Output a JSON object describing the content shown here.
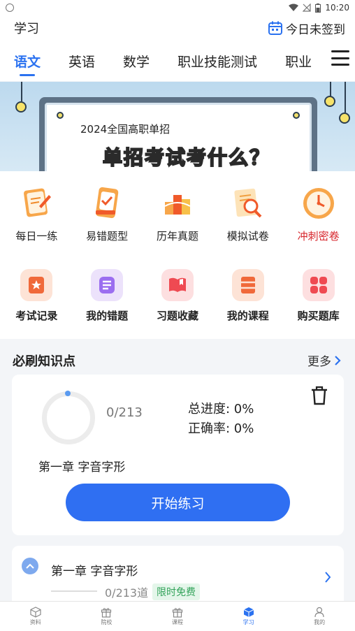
{
  "status_bar": {
    "time": "10:20"
  },
  "header": {
    "title": "学习",
    "checkin_label": "今日未签到"
  },
  "tabs": [
    {
      "label": "语文",
      "active": true
    },
    {
      "label": "英语",
      "active": false
    },
    {
      "label": "数学",
      "active": false
    },
    {
      "label": "职业技能测试",
      "active": false
    },
    {
      "label": "职业",
      "active": false
    }
  ],
  "banner": {
    "subtitle": "2024全国高职单招",
    "headline": "单招考试考什么？"
  },
  "grid_row1": [
    {
      "label": "每日一练",
      "icon": "daily-practice-icon"
    },
    {
      "label": "易错题型",
      "icon": "error-prone-icon"
    },
    {
      "label": "历年真题",
      "icon": "past-papers-icon"
    },
    {
      "label": "模拟试卷",
      "icon": "mock-exam-icon"
    },
    {
      "label": "冲刺密卷",
      "icon": "sprint-clock-icon",
      "highlight": "#d7262c"
    }
  ],
  "grid_row2": [
    {
      "label": "考试记录",
      "icon": "exam-record-icon",
      "bg": "#fde3d6",
      "fg": "#f0693a"
    },
    {
      "label": "我的错题",
      "icon": "my-mistakes-icon",
      "bg": "#ece2fb",
      "fg": "#9b6ef0"
    },
    {
      "label": "习题收藏",
      "icon": "favorites-icon",
      "bg": "#fddfe0",
      "fg": "#ef4a52"
    },
    {
      "label": "我的课程",
      "icon": "my-courses-icon",
      "bg": "#fde3d6",
      "fg": "#f0693a"
    },
    {
      "label": "购买题库",
      "icon": "buy-bank-icon",
      "bg": "#fddfe0",
      "fg": "#ef4a52"
    }
  ],
  "section": {
    "title": "必刷知识点",
    "more_label": "更多"
  },
  "progress_card": {
    "count": "0/213",
    "total_progress": "总进度: 0%",
    "accuracy": "正确率: 0%",
    "chapter": "第一章 字音字形",
    "start_label": "开始练习"
  },
  "chapter_card": {
    "title": "第一章 字音字形",
    "count": "0/213道",
    "badge": "限时免费"
  },
  "bottom_nav": [
    {
      "label": "资料",
      "icon": "box-icon",
      "active": false
    },
    {
      "label": "院校",
      "icon": "gift-icon",
      "active": false
    },
    {
      "label": "课程",
      "icon": "gift-icon",
      "active": false
    },
    {
      "label": "学习",
      "icon": "cube-icon",
      "active": true
    },
    {
      "label": "我的",
      "icon": "user-icon",
      "active": false
    }
  ],
  "colors": {
    "accent": "#2b72f0",
    "button": "#2f6ff2",
    "free_badge": "#32a35a"
  }
}
